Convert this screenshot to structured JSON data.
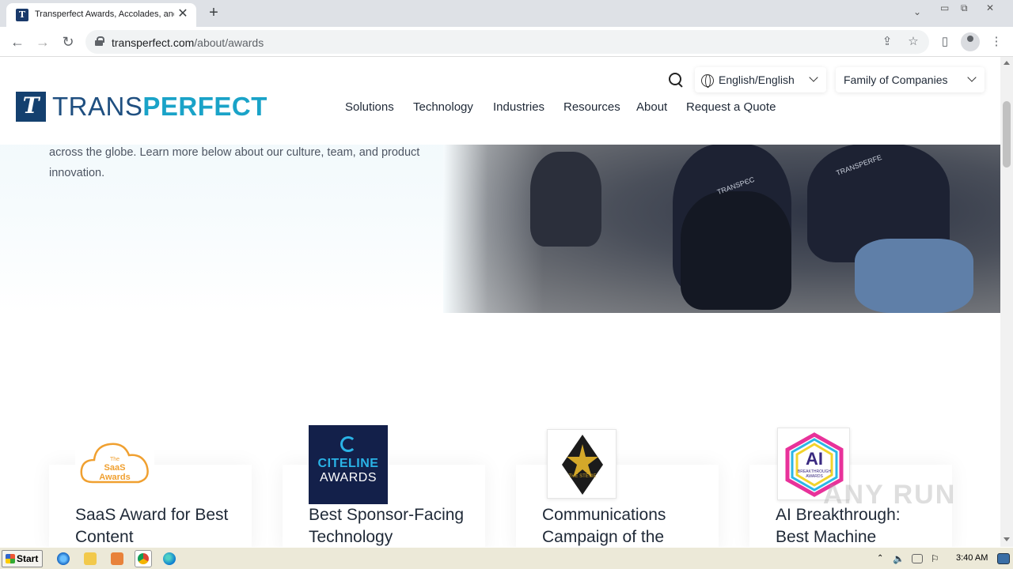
{
  "browser": {
    "tab_title": "Transperfect Awards, Accolades, and",
    "tab_favicon": "T",
    "url_host": "transperfect.com",
    "url_path": "/about/awards"
  },
  "header": {
    "logo_plain": "TRANS",
    "logo_bold": "PERFECT",
    "logo_mark": "T",
    "nav": [
      "Solutions",
      "Technology",
      "Industries",
      "Resources",
      "About",
      "Request a Quote"
    ],
    "language": "English/English",
    "family": "Family of Companies"
  },
  "hero": {
    "text": "across the globe. Learn more below about our culture, team, and product innovation.",
    "shirt_label_1": "TRANSPЄC",
    "shirt_label_2": "TRANSPERFE"
  },
  "awards": [
    {
      "title": "SaaS Award for Best Content",
      "badge_line1": "The",
      "badge_line2": "SaaS",
      "badge_line3": "Awards"
    },
    {
      "title": "Best Sponsor-Facing Technology",
      "badge_line1": "CITELINE",
      "badge_line2": "AWARDS"
    },
    {
      "title": "Communications Campaign of the",
      "badge_line1": "THE STEVIE"
    },
    {
      "title": "AI Breakthrough: Best Machine",
      "badge_line1": "AI",
      "badge_line2": "BREAKTHROUGH AWARDS"
    }
  ],
  "watermark": "ANY RUN",
  "taskbar": {
    "start": "Start",
    "clock": "3:40 AM"
  },
  "colors": {
    "brand_navy": "#1f4f80",
    "brand_cyan": "#1aa3c8",
    "citeline_bg": "#13204a",
    "saas_orange": "#f0a030"
  }
}
